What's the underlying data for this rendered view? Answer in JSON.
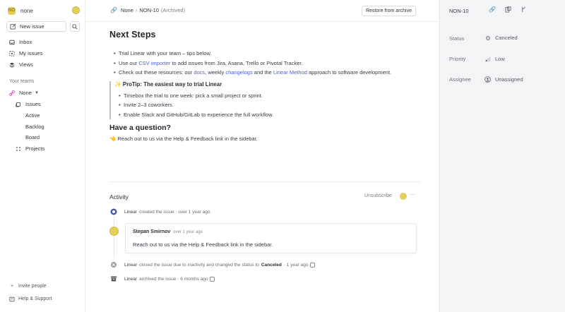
{
  "sidebar": {
    "workspace_badge": "NO",
    "workspace_name": "none",
    "new_issue": "New issue",
    "nav": [
      {
        "label": "Inbox",
        "icon": "inbox-icon"
      },
      {
        "label": "My issues",
        "icon": "my-issues-icon"
      },
      {
        "label": "Views",
        "icon": "layers-icon"
      }
    ],
    "teams_label": "Your teams",
    "team_name": "None",
    "team_items": [
      "Issues",
      "Active",
      "Backlog",
      "Board",
      "Projects"
    ],
    "invite": "Invite people",
    "help": "Help & Support"
  },
  "topbar": {
    "team": "None",
    "separator": "›",
    "issue_id": "NON-10",
    "archived": "(Archived)",
    "restore": "Restore from archive"
  },
  "doc": {
    "title": "Next Steps",
    "bullet1": "Trial Linear with your team – tips below.",
    "bullet2_pre": "Use our ",
    "bullet2_link": "CSV importer",
    "bullet2_post": " to add issues from Jira, Asana, Trello or Pivotal Tracker.",
    "bullet3_pre": "Check out these resources: our ",
    "bullet3_link1": "docs",
    "bullet3_mid1": ", weekly ",
    "bullet3_link2": "changelogs",
    "bullet3_mid2": " and the ",
    "bullet3_link3": "Linear Method",
    "bullet3_post": " approach to software development.",
    "tip_title": "✨ ProTip: The easiest way to trial Linear",
    "tip_items": [
      "Timebox the trial to one week: pick a small project or sprint.",
      "Invite 2–3 coworkers.",
      "Enable Slack and GitHub/GitLab to experience the full workflow."
    ],
    "question_title": "Have a question?",
    "reachout": "👈 Reach out to us via the Help & Feedback link in the sidebar."
  },
  "activity": {
    "heading": "Activity",
    "unsubscribe": "Unsubscribe",
    "more": "···",
    "event1_actor": "Linear",
    "event1_text": "created the issue · over 1 year ago",
    "comment_author": "Stepan Smirnov",
    "comment_ago": "over 1 year ago",
    "comment_body": "Reach out to us via the Help & Feedback link in the sidebar.",
    "event2_actor": "Linear",
    "event2_text": "closed the issue due to inactivity and changed the status to",
    "event2_status": "Canceled",
    "event2_ago": "· 1 year ago",
    "event3_actor": "Linear",
    "event3_text": "archived the issue · 6 months ago"
  },
  "panel": {
    "issue_id": "NON-10",
    "status_label": "Status",
    "status_value": "Canceled",
    "priority_label": "Priority",
    "priority_value": "Low",
    "assignee_label": "Assignee",
    "assignee_value": "Unassigned"
  },
  "colors": {
    "accent_link": "#4b5fd8",
    "team_pink": "#d44ab8",
    "avatar_yellow": "#e3cf5a"
  }
}
